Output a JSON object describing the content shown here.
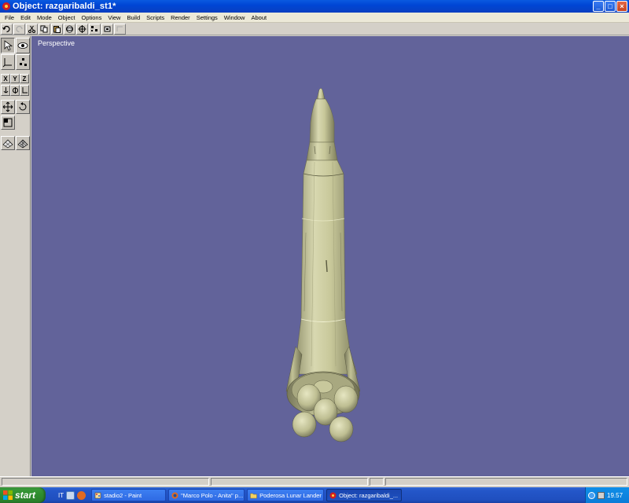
{
  "window": {
    "title": "Object: razgaribaldi_st1*",
    "controls": [
      "minimize",
      "maximize",
      "close"
    ]
  },
  "menu": [
    "File",
    "Edit",
    "Mode",
    "Object",
    "Options",
    "View",
    "Build",
    "Scripts",
    "Render",
    "Settings",
    "Window",
    "About"
  ],
  "toolbar": {
    "icons": [
      "undo-icon",
      "redo-icon",
      "cut-icon",
      "copy-icon",
      "paste-icon",
      "sphere-icon",
      "target-icon",
      "points-icon",
      "box-icon",
      "disabled-icon"
    ]
  },
  "palette": {
    "axes": [
      "X",
      "Y",
      "Z"
    ]
  },
  "viewport": {
    "label": "Perspective",
    "background": "#62639a",
    "model_color": "#c9c89c"
  },
  "taskbar": {
    "start_label": "start",
    "language": "IT",
    "tasks": [
      {
        "label": "stadio2 - Paint",
        "active": false
      },
      {
        "label": "\"Marco Polo - Anita\" p...",
        "active": false
      },
      {
        "label": "Poderosa Lunar Lander",
        "active": false
      },
      {
        "label": "Object: razgaribaldi_...",
        "active": true
      }
    ],
    "clock": "19.57"
  }
}
